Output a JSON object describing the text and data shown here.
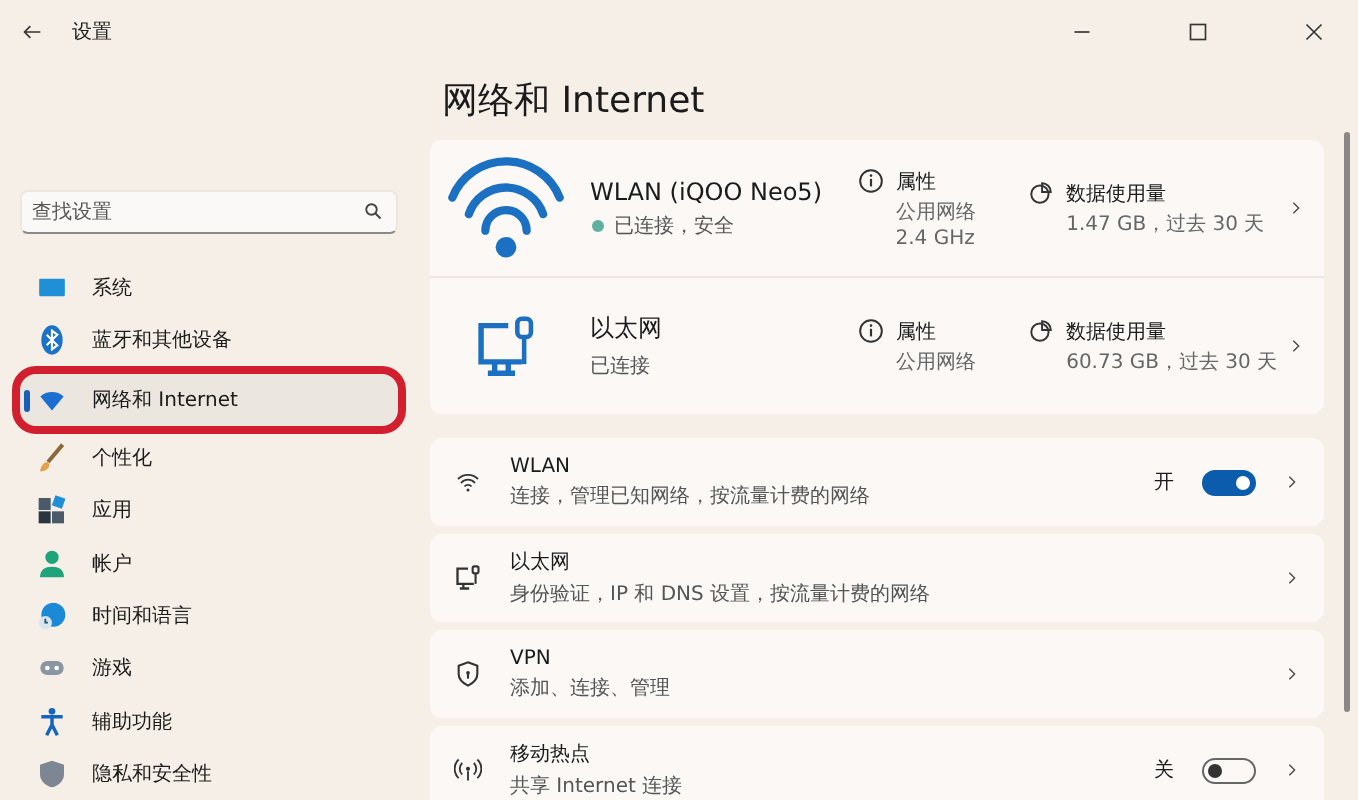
{
  "window": {
    "title": "设置"
  },
  "search": {
    "placeholder": "查找设置"
  },
  "nav": [
    {
      "kind": "system",
      "label": "系统",
      "selected": false
    },
    {
      "kind": "bluetooth",
      "label": "蓝牙和其他设备",
      "selected": false
    },
    {
      "kind": "network",
      "label": "网络和 Internet",
      "selected": true
    },
    {
      "kind": "personalize",
      "label": "个性化",
      "selected": false
    },
    {
      "kind": "apps",
      "label": "应用",
      "selected": false
    },
    {
      "kind": "account",
      "label": "帐户",
      "selected": false
    },
    {
      "kind": "time",
      "label": "时间和语言",
      "selected": false
    },
    {
      "kind": "gaming",
      "label": "游戏",
      "selected": false
    },
    {
      "kind": "accessibility",
      "label": "辅助功能",
      "selected": false
    },
    {
      "kind": "privacy",
      "label": "隐私和安全性",
      "selected": false
    }
  ],
  "heading": "网络和 Internet",
  "connections": [
    {
      "kind": "wifi",
      "name": "WLAN (iQOO Neo5)",
      "status": "已连接，安全",
      "properties_label": "属性",
      "properties": [
        "公用网络",
        "2.4 GHz"
      ],
      "usage_label": "数据使用量",
      "usage": "1.47 GB，过去 30 天"
    },
    {
      "kind": "ethernet",
      "name": "以太网",
      "status": "已连接",
      "properties_label": "属性",
      "properties": [
        "公用网络"
      ],
      "usage_label": "数据使用量",
      "usage": "60.73 GB，过去 30 天"
    }
  ],
  "settings": [
    {
      "kind": "wifi",
      "title": "WLAN",
      "subtitle": "连接，管理已知网络，按流量计费的网络",
      "toggle": {
        "on": true,
        "label": "开"
      }
    },
    {
      "kind": "ethernet",
      "title": "以太网",
      "subtitle": "身份验证，IP 和 DNS 设置，按流量计费的网络"
    },
    {
      "kind": "vpn",
      "title": "VPN",
      "subtitle": "添加、连接、管理"
    },
    {
      "kind": "hotspot",
      "title": "移动热点",
      "subtitle": "共享 Internet 连接",
      "toggle": {
        "on": false,
        "label": "关"
      }
    }
  ]
}
